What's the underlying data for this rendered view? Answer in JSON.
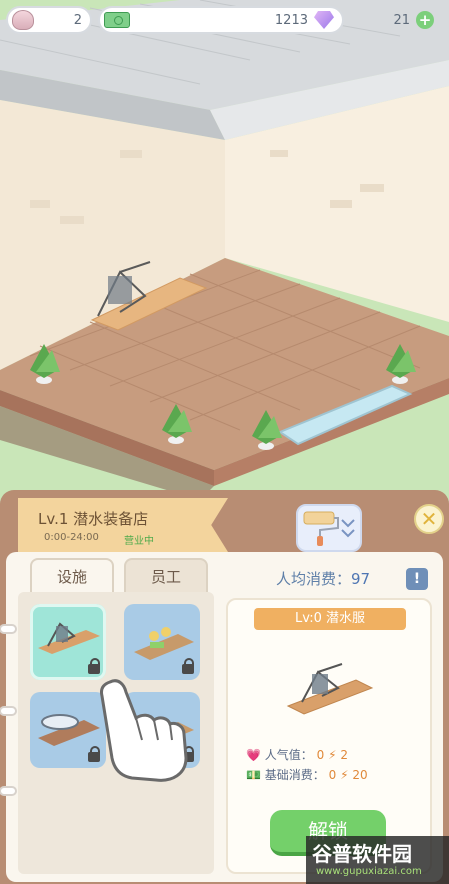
{
  "hud": {
    "hearts": "2",
    "money": "1213",
    "gems": "21",
    "add_label": "+"
  },
  "shop": {
    "title": "Lv.1 潜水装备店",
    "hours": "0:00-24:00",
    "status": "营业中"
  },
  "tabs": [
    {
      "label": "设施",
      "active": true
    },
    {
      "label": "员工",
      "active": false
    }
  ],
  "avg_spend": {
    "label": "人均消费：",
    "value": "97"
  },
  "info_label": "!",
  "close_label": "✕",
  "facilities": [
    {
      "icon": "wetsuit-rack-icon",
      "selected": true,
      "locked": true
    },
    {
      "icon": "gear-shelf-icon",
      "selected": false,
      "locked": true
    },
    {
      "icon": "surfboard-icon",
      "selected": false,
      "locked": true
    },
    {
      "icon": "equipment-icon",
      "selected": false,
      "locked": true
    }
  ],
  "detail": {
    "name": "Lv:0 潜水服",
    "popularity_label": "人气值：",
    "popularity_value": "0",
    "popularity_bonus": "2",
    "base_spend_label": "基础消费：",
    "base_spend_value": "0",
    "base_spend_bonus": "20",
    "unlock_label": "解锁"
  },
  "watermark": {
    "text": "谷普软件园",
    "url": "www.gupuxiazai.com"
  },
  "colors": {
    "panel_brown": "#b88d73",
    "banner": "#f3d49d",
    "unlock_green": "#74d06a",
    "item_orange": "#f0b061",
    "slot_blue": "#a9cbe6",
    "slot_selected": "#9fe5d8"
  }
}
